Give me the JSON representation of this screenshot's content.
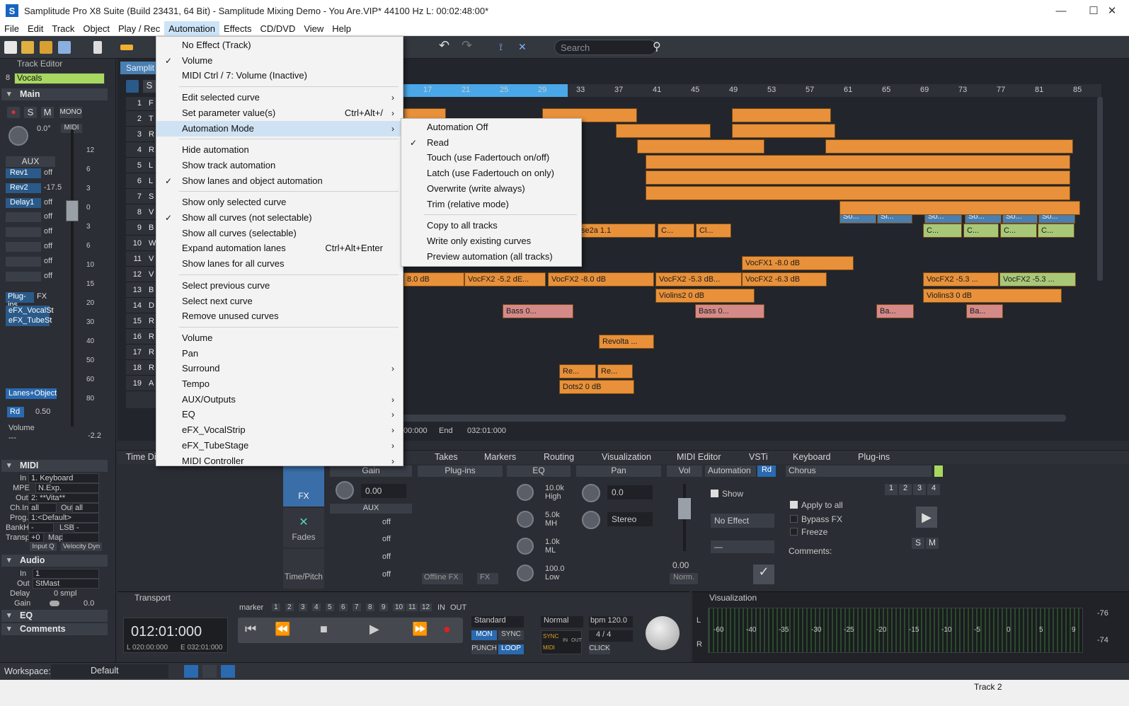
{
  "window": {
    "title": "Samplitude Pro X8 Suite (Build 23431, 64 Bit)  -  Samplitude Mixing Demo - You Are.VIP*   44100 Hz L: 00:02:48:00*",
    "minimize": "—",
    "maximize": "☐",
    "close": "✕"
  },
  "menubar": [
    "File",
    "Edit",
    "Track",
    "Object",
    "Play / Rec",
    "Automation",
    "Effects",
    "CD/DVD",
    "View",
    "Help"
  ],
  "toolbar": {
    "search_placeholder": "Search"
  },
  "track_editor": {
    "title": "Track Editor",
    "track_number": "8",
    "track_name": "Vocals",
    "main_label": "Main",
    "mono_label": "MONO",
    "midi_label": "MIDI",
    "aux_label": "AUX",
    "pan_value": "0.0°",
    "sends": [
      {
        "name": "Rev1",
        "value": "off"
      },
      {
        "name": "Rev2",
        "value": "-17.5"
      },
      {
        "name": "Delay1",
        "value": "off"
      },
      {
        "name": "",
        "value": "off"
      },
      {
        "name": "",
        "value": "off"
      },
      {
        "name": "",
        "value": "off"
      },
      {
        "name": "",
        "value": "off"
      },
      {
        "name": "",
        "value": "off"
      }
    ],
    "plugins_label": "Plug-ins",
    "fx_label": "FX",
    "plugins": [
      "eFX_VocalSt",
      "eFX_TubeSt"
    ],
    "lanes_label": "Lanes+Object",
    "rd_label": "Rd",
    "rd_value": "0.50",
    "volume_label": "Volume",
    "volume_value": "---",
    "fader_value": "-2.2",
    "scale": [
      "12",
      "6",
      "3",
      "0",
      "3",
      "6",
      "10",
      "15",
      "20",
      "30",
      "40",
      "50",
      "60",
      "80"
    ],
    "midi_section": "MIDI",
    "midi_in_label": "In",
    "midi_in": "1. Keyboard",
    "mpe_label": "MPE",
    "mpe_value": "N.Exp.",
    "midi_out_label": "Out",
    "midi_out": "2: **Vita**",
    "chin_label": "Ch.In",
    "chin_value": "all",
    "chout_label": "Out",
    "chout_value": "all",
    "prog_label": "Prog.",
    "prog_value": "1:<Default>",
    "bankhi_label": "BankHi",
    "bankhi_value": "-",
    "lsb_label": "LSB",
    "lsb_value": "-",
    "transp_label": "Transp.",
    "transp_value": "+0",
    "map_label": "Map",
    "inputq_label": "Input Q",
    "veldyn_label": "Velocity Dyn",
    "audio_section": "Audio",
    "audio_in_label": "In",
    "audio_in": "1",
    "audio_out_label": "Out",
    "audio_out": "StMast",
    "delay_label": "Delay",
    "delay_value": "0 smpl",
    "gain_label": "Gain",
    "gain_value": "0.0",
    "eq_section": "EQ",
    "comments_section": "Comments"
  },
  "arrange": {
    "tab_label": "Samplit",
    "ruler": [
      "17",
      "21",
      "25",
      "29",
      "33",
      "37",
      "41",
      "45",
      "49",
      "53",
      "57",
      "61",
      "65",
      "69",
      "73",
      "77",
      "81",
      "85"
    ],
    "tracks": [
      {
        "n": "1",
        "name": "F"
      },
      {
        "n": "2",
        "name": "T"
      },
      {
        "n": "3",
        "name": "R"
      },
      {
        "n": "4",
        "name": "R"
      },
      {
        "n": "5",
        "name": "L"
      },
      {
        "n": "6",
        "name": "L"
      },
      {
        "n": "7",
        "name": "S"
      },
      {
        "n": "8",
        "name": "V"
      },
      {
        "n": "9",
        "name": "B"
      },
      {
        "n": "10",
        "name": "W"
      },
      {
        "n": "11",
        "name": "V"
      },
      {
        "n": "12",
        "name": "V"
      },
      {
        "n": "13",
        "name": "B"
      },
      {
        "n": "14",
        "name": "D"
      },
      {
        "n": "15",
        "name": "R"
      },
      {
        "n": "16",
        "name": "R"
      },
      {
        "n": "17",
        "name": "R"
      },
      {
        "n": "18",
        "name": "R"
      },
      {
        "n": "19",
        "name": "A"
      }
    ],
    "objects": [
      "So...",
      "Si...",
      "So...",
      "So...",
      "So...",
      "So...",
      "se2a  1.1",
      "C...",
      "Cl...",
      "C...",
      "C...",
      "C...",
      "C...",
      "VocFX1  -8.0 dB",
      "8.0 dB",
      "VocFX2  -5.2 dE...",
      "VocFX2  -8.0 dB",
      "VocFX2  -5.3 dB...",
      "VocFX2  -6.3 dB",
      "VocFX2  -5.3 ...",
      "VocFX2  -5.3 ...",
      "Violins2  0 dB",
      "Violins3  0 dB",
      "Bass  0...",
      "Bass  0...",
      "Ba...",
      "Ba...",
      "Revolta ...",
      "Re...",
      "Re...",
      "Dots2  0 dB"
    ],
    "pos_label": "00:000",
    "end_label": "End",
    "end_value": "032:01:000"
  },
  "bottom_tabs": [
    "Time Di",
    "Takes",
    "Markers",
    "Routing",
    "Visualization",
    "MIDI Editor",
    "VSTi",
    "Keyboard",
    "Plug-ins"
  ],
  "mixer_panel": {
    "fx_label": "FX",
    "fades_label": "Fades",
    "timepitch_label": "Time/Pitch",
    "gain_label": "Gain",
    "gain_value": "0.00",
    "aux_label": "AUX",
    "aux_sends": [
      "off",
      "off",
      "off",
      "off"
    ],
    "plugins_label": "Plug-ins",
    "offline_fx": "Offline FX",
    "fx_small": "FX",
    "eq_label": "EQ",
    "eq_bands": [
      {
        "value": "10.0k",
        "band": "High"
      },
      {
        "value": "5.0k",
        "band": "MH"
      },
      {
        "value": "1.0k",
        "band": "ML"
      },
      {
        "value": "100.0",
        "band": "Low"
      }
    ],
    "pan_label": "Pan",
    "pan_value": "0.0",
    "stereo_label": "Stereo",
    "vol_label": "Vol",
    "vol_value": "0.00",
    "norm_label": "Norm.",
    "automation_label": "Automation",
    "rd_label": "Rd",
    "show_label": "Show",
    "no_effect": "No Effect",
    "dash": "—",
    "chorus_label": "Chorus",
    "presets": [
      "1",
      "2",
      "3",
      "4"
    ],
    "apply_all": "Apply to all",
    "bypass": "Bypass FX",
    "freeze": "Freeze",
    "comments": "Comments:",
    "s": "S",
    "m": "M"
  },
  "transport": {
    "title": "Transport",
    "marker_label": "marker",
    "markers": [
      "1",
      "2",
      "3",
      "4",
      "5",
      "6",
      "7",
      "8",
      "9",
      "10",
      "11",
      "12"
    ],
    "in_label": "IN",
    "out_label": "OUT",
    "time": "012:01:000",
    "l_time": "L 020:00:000",
    "e_time": "E  032:01:000",
    "mode": "Standard",
    "mon": "MON",
    "sync": "SYNC",
    "punch": "PUNCH",
    "loop": "LOOP",
    "normal": "Normal",
    "bpm": "bpm 120.0",
    "sig": "4 / 4",
    "click": "CLICK",
    "sync_small": "SYNC",
    "midi_small": "MIDI",
    "in_small": "IN",
    "out_small": "OUT"
  },
  "visualization": {
    "title": "Visualization",
    "scale": [
      "-60",
      "-40",
      "-35",
      "-30",
      "-25",
      "-20",
      "-15",
      "-10",
      "-5",
      "0",
      "5",
      "9"
    ],
    "right": [
      "-76",
      "-74"
    ],
    "l": "L",
    "r": "R"
  },
  "workspace": {
    "label": "Workspace:",
    "value": "Default"
  },
  "statusbar": {
    "track": "Track 2"
  },
  "automation_menu": [
    {
      "label": "No Effect  (Track)",
      "check": "",
      "sc": "",
      "arrow": ""
    },
    {
      "label": "Volume",
      "check": "✓",
      "sc": "",
      "arrow": ""
    },
    {
      "label": "MIDI Ctrl /   7: Volume (Inactive)",
      "check": "",
      "sc": "",
      "arrow": ""
    },
    {
      "sep": true
    },
    {
      "label": "Edit selected curve",
      "check": "",
      "sc": "",
      "arrow": "›"
    },
    {
      "label": "Set parameter value(s)",
      "check": "",
      "sc": "Ctrl+Alt+/",
      "arrow": "›"
    },
    {
      "label": "Automation Mode",
      "check": "",
      "sc": "",
      "arrow": "›",
      "hl": true
    },
    {
      "sep": true
    },
    {
      "label": "Hide automation",
      "check": "",
      "sc": "",
      "arrow": ""
    },
    {
      "label": "Show track automation",
      "check": "",
      "sc": "",
      "arrow": ""
    },
    {
      "label": "Show lanes and object automation",
      "check": "✓",
      "sc": "",
      "arrow": ""
    },
    {
      "sep": true
    },
    {
      "label": "Show only selected curve",
      "check": "",
      "sc": "",
      "arrow": ""
    },
    {
      "label": "Show all curves (not selectable)",
      "check": "✓",
      "sc": "",
      "arrow": ""
    },
    {
      "label": "Show all curves (selectable)",
      "check": "",
      "sc": "",
      "arrow": ""
    },
    {
      "label": "Expand automation lanes",
      "check": "",
      "sc": "Ctrl+Alt+Enter",
      "arrow": ""
    },
    {
      "label": "Show lanes for all curves",
      "check": "",
      "sc": "",
      "arrow": ""
    },
    {
      "sep": true
    },
    {
      "label": "Select previous curve",
      "check": "",
      "sc": "",
      "arrow": ""
    },
    {
      "label": "Select next curve",
      "check": "",
      "sc": "",
      "arrow": ""
    },
    {
      "label": "Remove unused curves",
      "check": "",
      "sc": "",
      "arrow": ""
    },
    {
      "sep": true
    },
    {
      "label": "Volume",
      "check": "",
      "sc": "",
      "arrow": ""
    },
    {
      "label": "Pan",
      "check": "",
      "sc": "",
      "arrow": ""
    },
    {
      "label": "Surround",
      "check": "",
      "sc": "",
      "arrow": "›"
    },
    {
      "label": "Tempo",
      "check": "",
      "sc": "",
      "arrow": ""
    },
    {
      "label": "AUX/Outputs",
      "check": "",
      "sc": "",
      "arrow": "›"
    },
    {
      "label": "EQ",
      "check": "",
      "sc": "",
      "arrow": "›"
    },
    {
      "label": "eFX_VocalStrip",
      "check": "",
      "sc": "",
      "arrow": "›"
    },
    {
      "label": "eFX_TubeStage",
      "check": "",
      "sc": "",
      "arrow": "›"
    },
    {
      "label": "MIDI Controller",
      "check": "",
      "sc": "",
      "arrow": "›"
    }
  ],
  "mode_menu": [
    {
      "label": "Automation Off",
      "check": ""
    },
    {
      "label": "Read",
      "check": "✓"
    },
    {
      "label": "Touch (use Fadertouch on/off)",
      "check": ""
    },
    {
      "label": "Latch (use Fadertouch on only)",
      "check": ""
    },
    {
      "label": "Overwrite (write always)",
      "check": ""
    },
    {
      "label": "Trim (relative mode)",
      "check": ""
    },
    {
      "sep": true
    },
    {
      "label": "Copy to all tracks",
      "check": ""
    },
    {
      "label": "Write only existing curves",
      "check": ""
    },
    {
      "label": "Preview automation (all tracks)",
      "check": ""
    }
  ],
  "colors": {
    "accent": "#e8913a",
    "blue": "#4a7fb0",
    "menu_hl": "#cfe2f3"
  }
}
